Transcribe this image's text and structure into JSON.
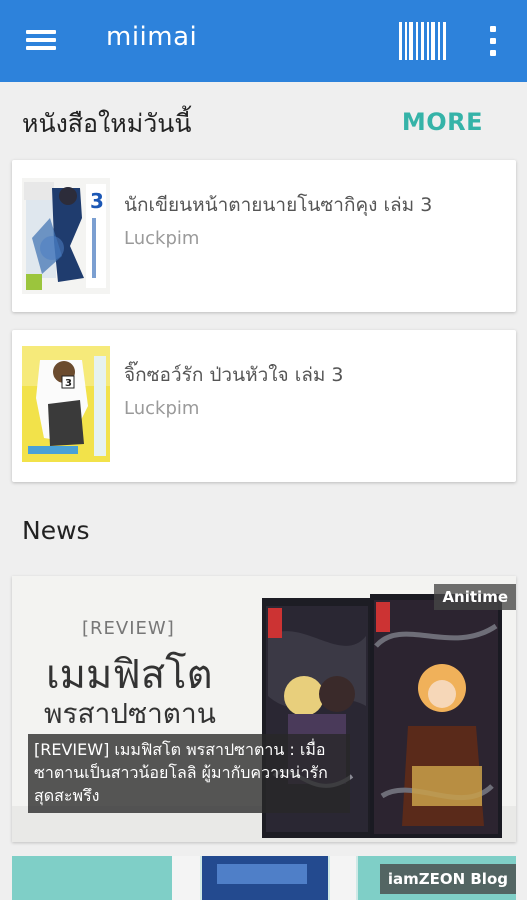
{
  "app": {
    "title": "miimai"
  },
  "new_books": {
    "heading": "หนังสือใหม่วันนี้",
    "more_label": "MORE",
    "items": [
      {
        "title": "นักเขียนหน้าตายนายโนซากิคุง เล่ม 3",
        "author": "Luckpim",
        "cover_text": "3"
      },
      {
        "title": "จิ๊กซอว์รัก ป่วนหัวใจ เล่ม 3",
        "author": "Luckpim",
        "cover_text": "3"
      }
    ]
  },
  "news": {
    "heading": "News",
    "items": [
      {
        "source": "Anitime",
        "image_headline_small": "[REVIEW]",
        "image_headline_big1": "เมมฟิสโต",
        "image_headline_big2": "พรสาปซาตาน",
        "caption": "[REVIEW] เมมฟิสโต พรสาปซาตาน : เมื่อซาตานเป็นสาวน้อยโลลิ ผู้มากับความน่ารักสุดสะพรึง"
      },
      {
        "source": "iamZEON Blog"
      }
    ]
  },
  "colors": {
    "app_bar": "#2d82db",
    "accent": "#35b3a8",
    "background": "#efefef"
  },
  "icons": {
    "menu": "hamburger-icon",
    "scan": "barcode-icon",
    "overflow": "more-vert-icon"
  }
}
